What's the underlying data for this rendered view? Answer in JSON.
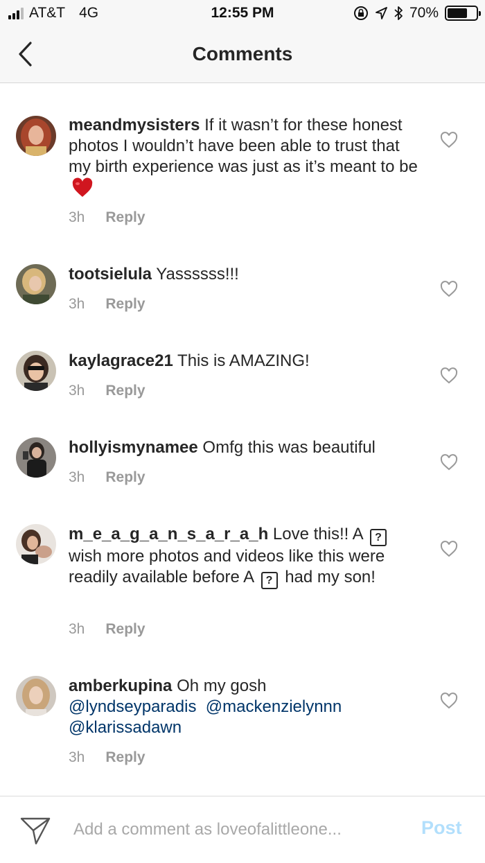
{
  "status_bar": {
    "carrier": "AT&T",
    "network": "4G",
    "time": "12:55 PM",
    "battery_percent": "70%",
    "battery_level": 0.7
  },
  "nav": {
    "title": "Comments"
  },
  "comments": [
    {
      "username": "meandmysisters",
      "text": "If it wasn’t for these honest photos I wouldn’t have been able to trust that my birth experience was just as it’s meant to be",
      "time": "3h",
      "reply_label": "Reply"
    },
    {
      "username": "tootsielula",
      "text": "Yassssss!!!",
      "time": "3h",
      "reply_label": "Reply"
    },
    {
      "username": "kaylagrace21",
      "text": "This is AMAZING!",
      "time": "3h",
      "reply_label": "Reply"
    },
    {
      "username": "hollyismynamee",
      "text": "Omfg this was beautiful",
      "time": "3h",
      "reply_label": "Reply"
    },
    {
      "username": "m_e_a_g_a_n_s_a_r_a_h",
      "text_1": "Love this!! A",
      "text_2": "wish more photos and videos like this were readily available before A",
      "text_3": "had my son!",
      "glyph": "?",
      "time": "3h",
      "reply_label": "Reply"
    },
    {
      "username": "amberkupina",
      "text": "Oh my gosh",
      "mentions": [
        "@lyndseyparadis",
        "@mackenzielynnn",
        "@klarissadawn"
      ],
      "time": "3h",
      "reply_label": "Reply"
    }
  ],
  "composer": {
    "placeholder": "Add a comment as loveofalittleone...",
    "post_label": "Post"
  },
  "colors": {
    "mention": "#003569",
    "meta": "#999999",
    "post_disabled": "#b2dffc",
    "heart_emoji": "#d0161f"
  }
}
